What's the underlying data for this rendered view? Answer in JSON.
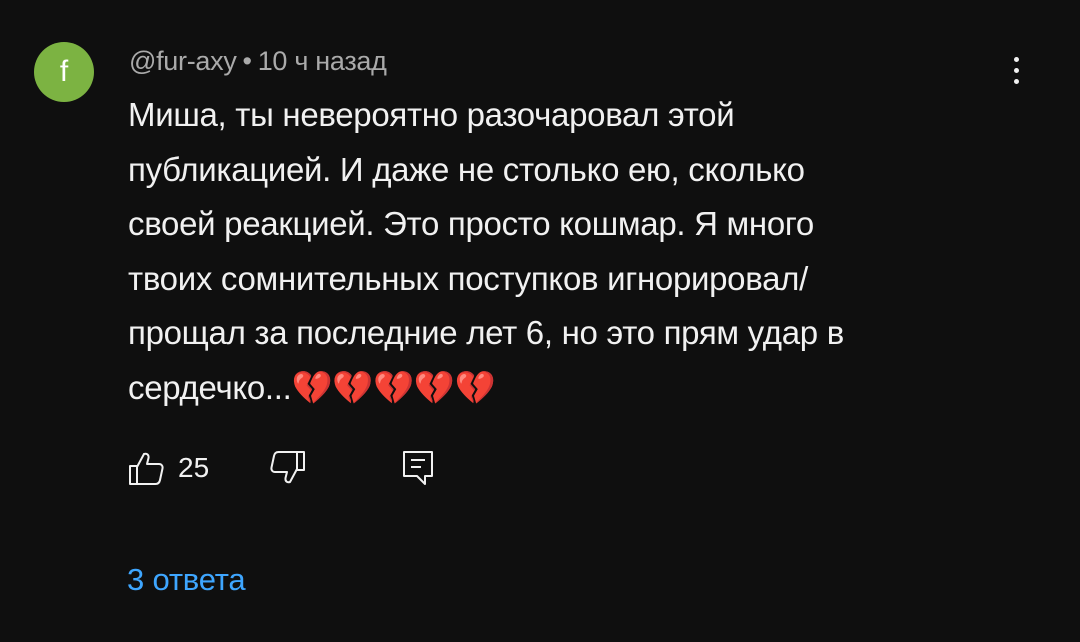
{
  "comment": {
    "avatar_letter": "f",
    "avatar_color": "#7cb342",
    "author": "@fur-axy",
    "separator": "•",
    "timestamp": "10 ч назад",
    "text": "Миша, ты невероятно разочаровал этой\nпубликацией. И даже не столько ею, сколько\nсвоей реакцией. Это просто кошмар. Я много\nтвоих сомнительных поступков игнорировал/\nпрощал за последние лет 6, но это  прям удар в\nсердечко...💔💔💔💔💔",
    "likes": "25",
    "replies_label": "3 ответа"
  },
  "icons": {
    "menu": "more-vert-icon",
    "like": "thumb-up-icon",
    "dislike": "thumb-down-icon",
    "reply": "reply-comment-icon"
  },
  "colors": {
    "background": "#0f0f0f",
    "text": "#f1f1f1",
    "secondary_text": "#aaaaaa",
    "link": "#3ea6ff"
  }
}
